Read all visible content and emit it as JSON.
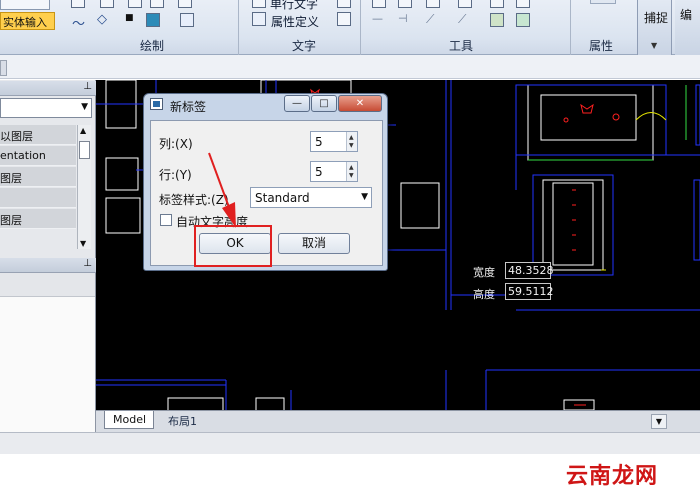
{
  "ribbon": {
    "solid_input_label": "实体输入",
    "groups": [
      {
        "title": "绘制"
      },
      {
        "title": "文字"
      },
      {
        "title": "工具"
      },
      {
        "title": "属性"
      }
    ],
    "text_tools": [
      {
        "label": "单行文字"
      },
      {
        "label": "属性定义"
      }
    ],
    "capture_label": "捕捉",
    "edit_label": "编"
  },
  "left_panel": {
    "layer_rows": [
      "以图层",
      "entation",
      "图层",
      "",
      "图层"
    ]
  },
  "drawing": {
    "width_label": "宽度",
    "width_value": "48.3528",
    "height_label": "高度",
    "height_value": "59.5112"
  },
  "layout_tabs": [
    {
      "label": "Model",
      "active": true
    },
    {
      "label": "布局1",
      "active": false
    }
  ],
  "dialog": {
    "title": "新标签",
    "columns_label": "列:(X)",
    "columns_value": "5",
    "rows_label": "行:(Y)",
    "rows_value": "5",
    "style_label": "标签样式:(Z)",
    "style_value": "Standard",
    "auto_height_label": "自动文字高度",
    "auto_height_checked": false,
    "ok_label": "OK",
    "cancel_label": "取消"
  },
  "watermark": "云南龙网",
  "colors": {
    "accent_highlight": "#e02020",
    "canvas_bg": "#000000",
    "cad_blue": "#2233ff",
    "cad_red": "#ff2020"
  }
}
